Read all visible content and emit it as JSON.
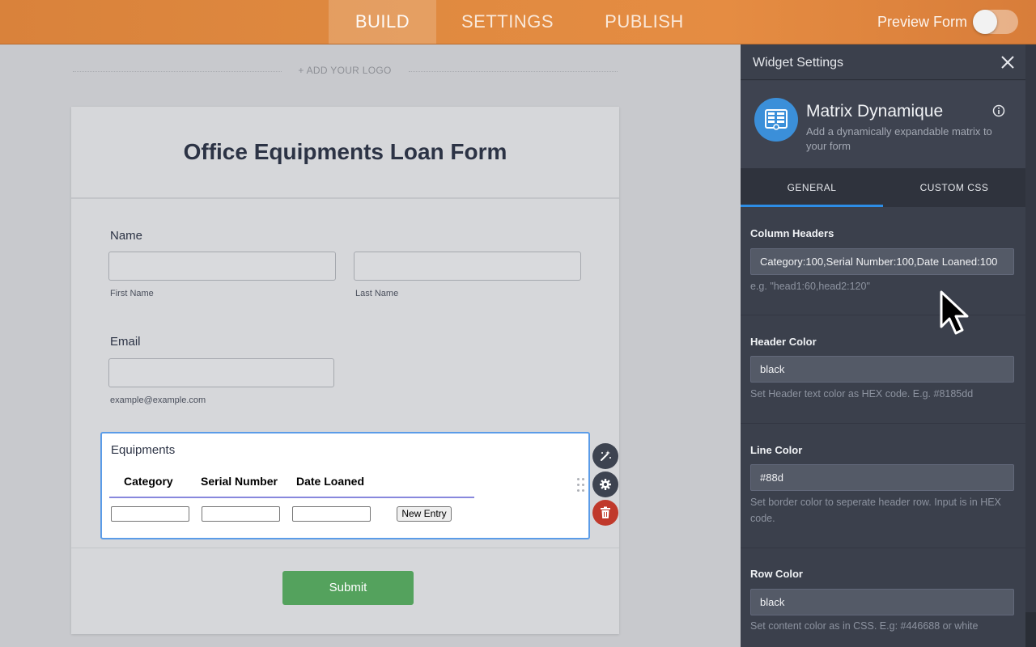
{
  "nav": {
    "tabs": [
      {
        "label": "BUILD",
        "active": true
      },
      {
        "label": "SETTINGS",
        "active": false
      },
      {
        "label": "PUBLISH",
        "active": false
      }
    ],
    "preview_label": "Preview Form",
    "preview_enabled": false
  },
  "canvas": {
    "add_logo": "+ ADD YOUR LOGO"
  },
  "form": {
    "title": "Office Equipments Loan Form",
    "name": {
      "label": "Name",
      "first_sublabel": "First Name",
      "last_sublabel": "Last Name",
      "first_value": "",
      "last_value": ""
    },
    "email": {
      "label": "Email",
      "sublabel": "example@example.com",
      "value": ""
    },
    "matrix": {
      "label": "Equipments",
      "columns": [
        "Category",
        "Serial Number",
        "Date Loaned"
      ],
      "new_entry_label": "New Entry"
    },
    "submit_label": "Submit"
  },
  "panel": {
    "title": "Widget Settings",
    "widget_name": "Matrix Dynamique",
    "widget_description": "Add a dynamically expandable matrix to your form",
    "tabs": [
      {
        "label": "GENERAL",
        "active": true
      },
      {
        "label": "CUSTOM CSS",
        "active": false
      }
    ],
    "settings": [
      {
        "label": "Column Headers",
        "value": "Category:100,Serial Number:100,Date Loaned:100",
        "help": "e.g. \"head1:60,head2:120\""
      },
      {
        "label": "Header Color",
        "value": "black",
        "help": "Set Header text color as HEX code. E.g. #8185dd"
      },
      {
        "label": "Line Color",
        "value": "#88d",
        "help": "Set border color to seperate header row. Input is in HEX code."
      },
      {
        "label": "Row Color",
        "value": "black",
        "help": "Set content color as in CSS. E.g: #446688 or white"
      }
    ]
  },
  "colors": {
    "topbar": "#e08a40",
    "panel_bg": "#3b404c",
    "accent_blue": "#2d8de5",
    "submit_green": "#54a25d",
    "delete_red": "#c0392b",
    "matrix_line": "#8888dd"
  }
}
